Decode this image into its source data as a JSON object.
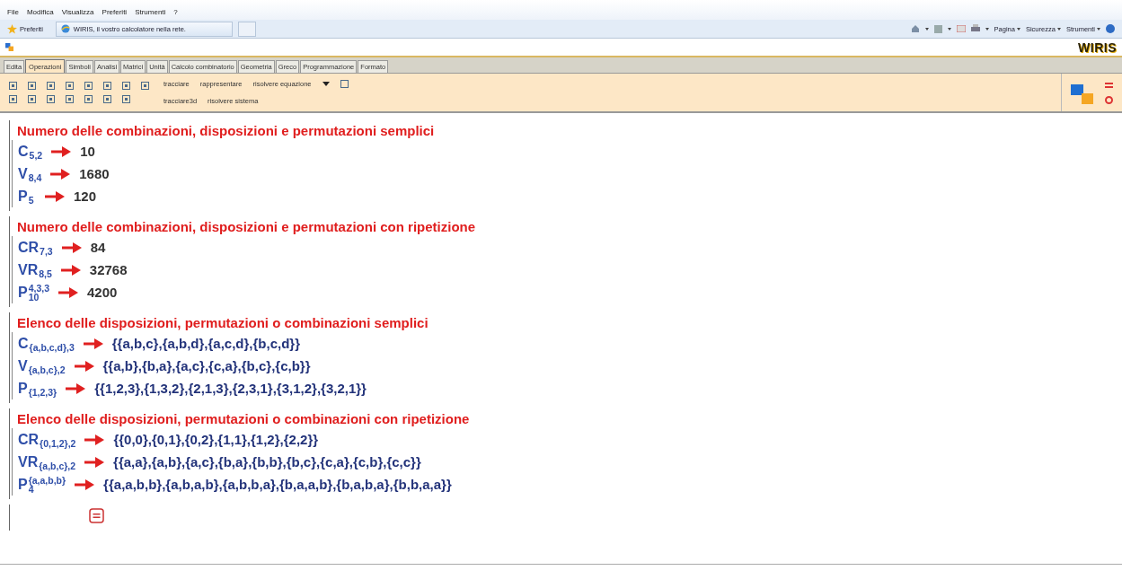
{
  "menu_bar": [
    "File",
    "Modifica",
    "Visualizza",
    "Preferiti",
    "Strumenti",
    "?"
  ],
  "favorites_bar": {
    "favorites": "Preferiti",
    "tab_title": "WIRIS, il vostro calcolatore nella rete.",
    "commands": [
      "Pagina",
      "Sicurezza",
      "Strumenti"
    ]
  },
  "app": {
    "logo": "WIRIS"
  },
  "tabs": [
    {
      "label": "Edita",
      "selected": false
    },
    {
      "label": "Operazioni",
      "selected": true
    },
    {
      "label": "Simboli",
      "selected": false
    },
    {
      "label": "Analisi",
      "selected": false
    },
    {
      "label": "Matrici",
      "selected": false
    },
    {
      "label": "Unità",
      "selected": false
    },
    {
      "label": "Calcolo combinatorio",
      "selected": false
    },
    {
      "label": "Geometria",
      "selected": false
    },
    {
      "label": "Greco",
      "selected": false
    },
    {
      "label": "Programmazione",
      "selected": false
    },
    {
      "label": "Formato",
      "selected": false
    }
  ],
  "toolbar": {
    "commands_top": [
      "tracciare",
      "rappresentare",
      "risolvere equazione"
    ],
    "commands_bottom": [
      "tracciare3d",
      "risolvere sistema"
    ]
  },
  "blocks": [
    {
      "title": "Numero delle combinazioni, disposizioni e permutazioni semplici",
      "rows": [
        {
          "symbol": "C",
          "sub": "5,2",
          "result": "10"
        },
        {
          "symbol": "V",
          "sub": "8,4",
          "result": "1680"
        },
        {
          "symbol": "P",
          "sub": "5",
          "result": "120"
        }
      ]
    },
    {
      "title": "Numero delle combinazioni, disposizioni e permutazioni con ripetizione",
      "rows": [
        {
          "symbol": "CR",
          "sub": "7,3",
          "result": "84"
        },
        {
          "symbol": "VR",
          "sub": "8,5",
          "result": "32768"
        },
        {
          "symbol": "P",
          "sub": "10",
          "sup": "4,3,3",
          "result": "4200"
        }
      ]
    },
    {
      "title": "Elenco delle disposizioni, permutazioni o combinazioni semplici",
      "rows": [
        {
          "symbol": "C",
          "sub": "{a,b,c,d},3",
          "result": "{{a,b,c},{a,b,d},{a,c,d},{b,c,d}}"
        },
        {
          "symbol": "V",
          "sub": "{a,b,c},2",
          "result": "{{a,b},{b,a},{a,c},{c,a},{b,c},{c,b}}"
        },
        {
          "symbol": "P",
          "sub": "{1,2,3}",
          "result": "{{1,2,3},{1,3,2},{2,1,3},{2,3,1},{3,1,2},{3,2,1}}"
        }
      ]
    },
    {
      "title": "Elenco delle disposizioni, permutazioni o combinazioni con ripetizione",
      "rows": [
        {
          "symbol": "CR",
          "sub": "{0,1,2},2",
          "result": "{{0,0},{0,1},{0,2},{1,1},{1,2},{2,2}}"
        },
        {
          "symbol": "VR",
          "sub": "{a,b,c},2",
          "result": "{{a,a},{a,b},{a,c},{b,a},{b,b},{b,c},{c,a},{c,b},{c,c}}"
        },
        {
          "symbol": "P",
          "sub": "4",
          "sup": "{a,a,b,b}",
          "result": "{{a,a,b,b},{a,b,a,b},{a,b,b,a},{b,a,a,b},{b,a,b,a},{b,b,a,a}}"
        }
      ]
    }
  ]
}
